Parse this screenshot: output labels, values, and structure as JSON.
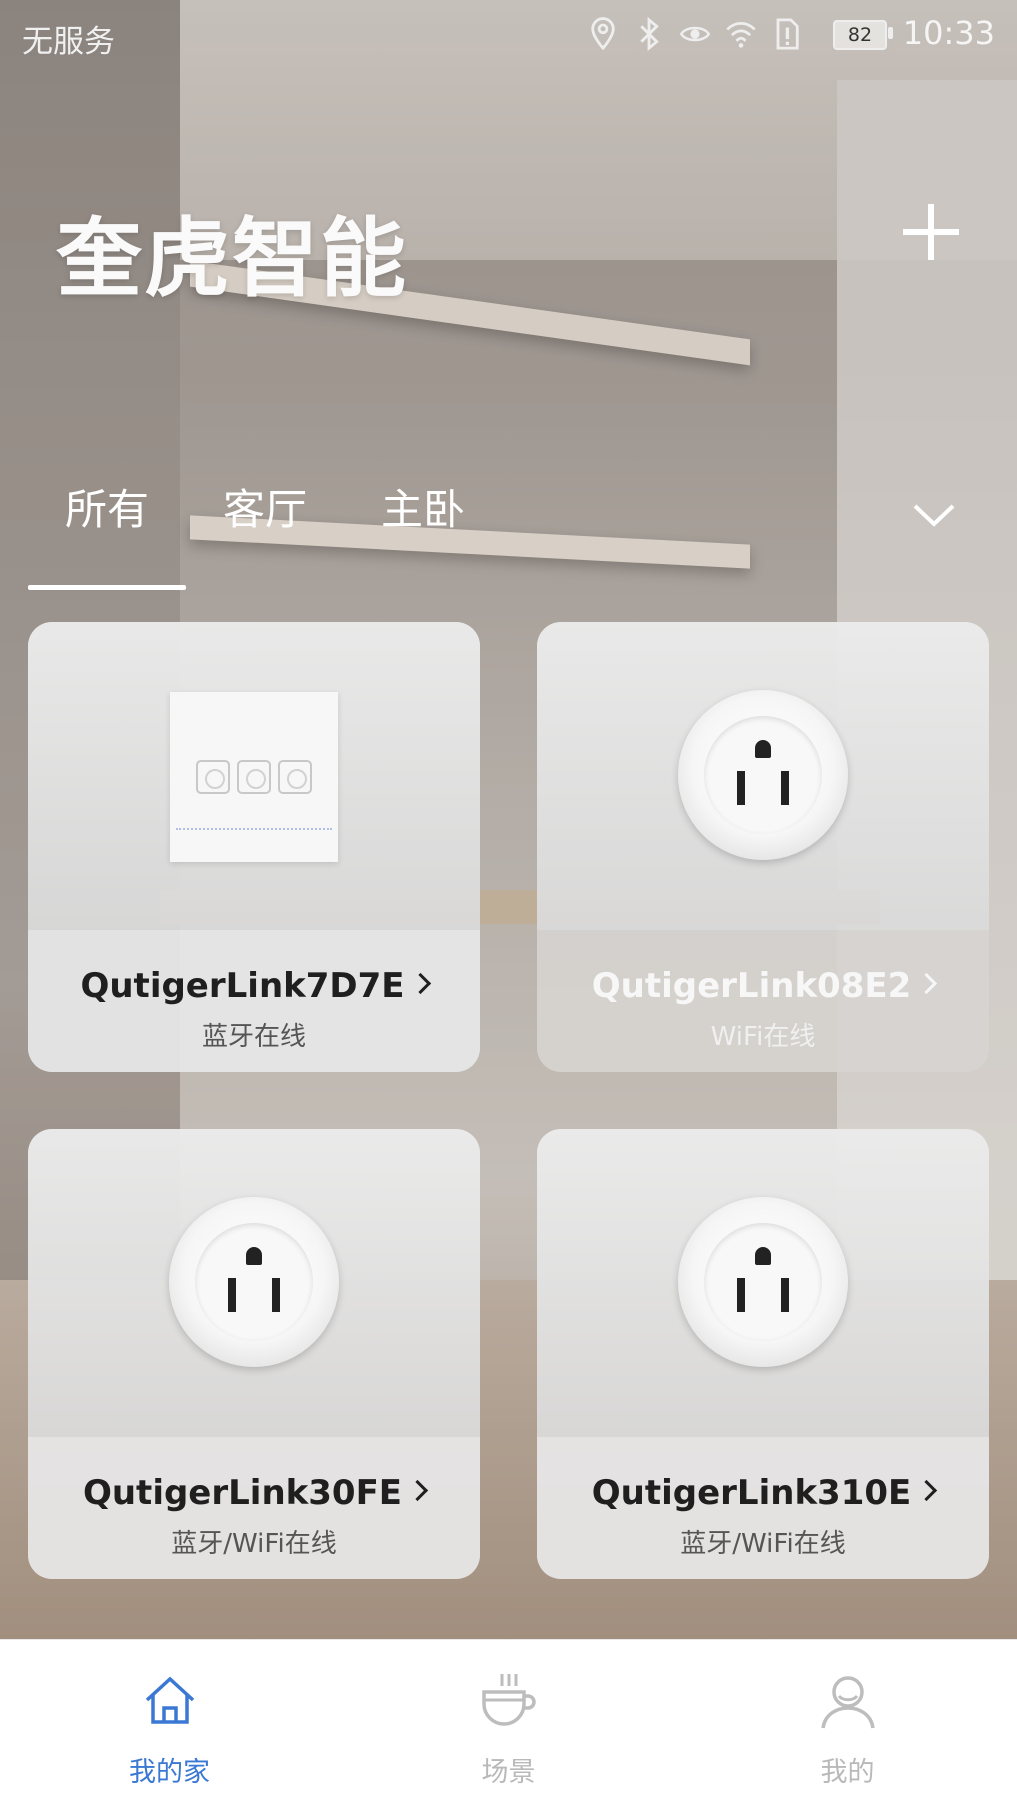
{
  "status_bar": {
    "carrier": "无服务",
    "battery": "82",
    "time": "10:33"
  },
  "header": {
    "title": "奎虎智能",
    "add_icon": "plus-icon"
  },
  "tabs": {
    "items": [
      {
        "label": "所有",
        "active": true
      },
      {
        "label": "客厅",
        "active": false
      },
      {
        "label": "主卧",
        "active": false
      }
    ],
    "dropdown_icon": "chevron-down-icon"
  },
  "devices": [
    {
      "name": "QutigerLink7D7E",
      "status": "蓝牙在线",
      "type": "switch-panel",
      "label_theme": "dark"
    },
    {
      "name": "QutigerLink08E2",
      "status": "WiFi在线",
      "type": "socket",
      "label_theme": "light"
    },
    {
      "name": "QutigerLink30FE",
      "status": "蓝牙/WiFi在线",
      "type": "socket",
      "label_theme": "dark"
    },
    {
      "name": "QutigerLink310E",
      "status": "蓝牙/WiFi在线",
      "type": "socket",
      "label_theme": "dark"
    }
  ],
  "bottom_nav": {
    "items": [
      {
        "label": "我的家",
        "icon": "home-icon",
        "active": true
      },
      {
        "label": "场景",
        "icon": "coffee-cup-icon",
        "active": false
      },
      {
        "label": "我的",
        "icon": "user-icon",
        "active": false
      }
    ],
    "active_color": "#3a78d3",
    "inactive_color": "#b9b9b9"
  }
}
